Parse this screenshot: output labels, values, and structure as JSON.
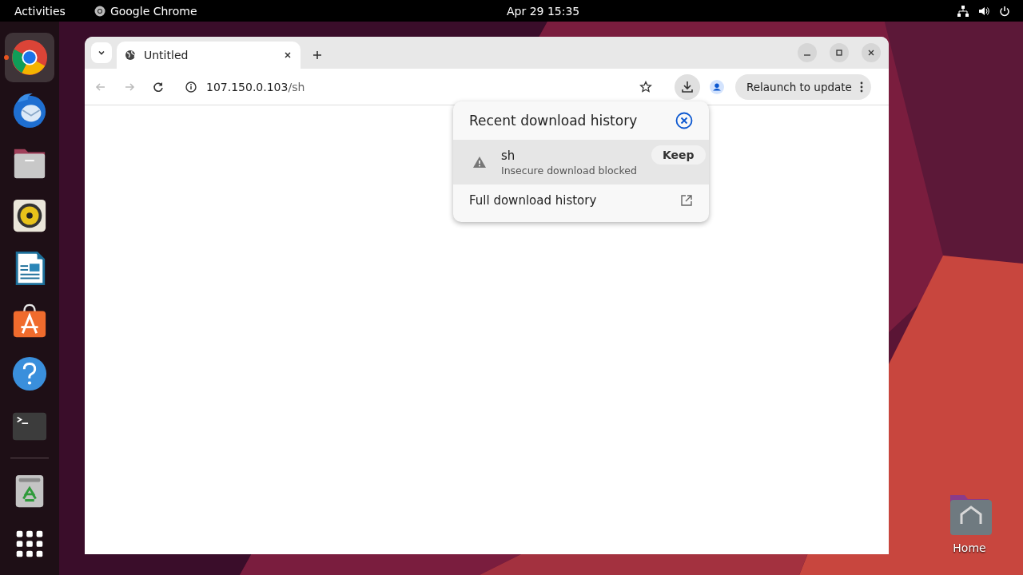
{
  "top_bar": {
    "activities": "Activities",
    "app_name": "Google Chrome",
    "clock": "Apr 29  15:35"
  },
  "dock": [
    {
      "kind": "chrome",
      "active": true
    },
    {
      "kind": "mail",
      "active": false
    },
    {
      "kind": "files",
      "active": false
    },
    {
      "kind": "music",
      "active": false
    },
    {
      "kind": "writer",
      "active": false
    },
    {
      "kind": "store",
      "active": false
    },
    {
      "kind": "help",
      "active": false
    },
    {
      "kind": "terminal",
      "active": false
    },
    {
      "kind": "trash",
      "active": false
    },
    {
      "kind": "apps",
      "active": false
    }
  ],
  "browser": {
    "tabs": [
      {
        "title": "Untitled",
        "selected": true
      }
    ],
    "address": {
      "host": "107.150.0.103",
      "path": "/sh"
    },
    "relaunch_button": "Relaunch to update",
    "downloads_panel": {
      "title": "Recent download history",
      "items": [
        {
          "name": "sh",
          "status": "Insecure download blocked",
          "action": "Keep"
        }
      ],
      "footer": "Full download history"
    }
  },
  "desktop_icons": [
    {
      "label": "Home"
    }
  ]
}
